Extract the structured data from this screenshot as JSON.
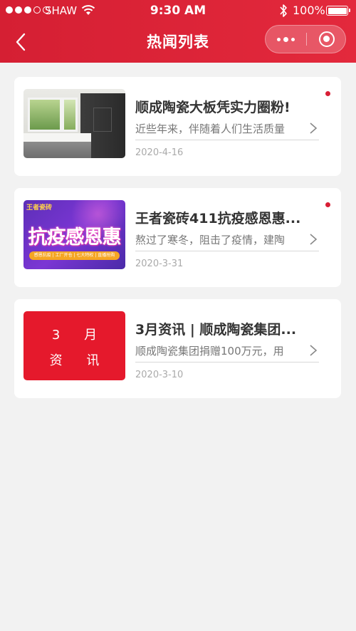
{
  "status_bar": {
    "carrier": "SHAW",
    "time": "9:30 AM",
    "battery": "100%",
    "signal_icon": "signal-dots-icon",
    "wifi_icon": "wifi-icon",
    "bluetooth_icon": "bluetooth-icon"
  },
  "nav": {
    "title": "热闻列表",
    "back_icon": "chevron-left-icon",
    "more_icon": "more-dots-icon",
    "close_icon": "target-circle-icon"
  },
  "colors": {
    "brand_red": "#d51f33",
    "unread_dot": "#d81e35",
    "background": "#f2f2f2"
  },
  "news": [
    {
      "title": "顺成陶瓷大板凭实力圈粉!",
      "summary": "近些年来，伴随着人们生活质量",
      "date": "2020-4-16",
      "unread": true,
      "thumbnail": "kitchen-photo"
    },
    {
      "title": "王者瓷砖411抗疫感恩惠...",
      "summary": "熬过了寒冬，阻击了疫情，建陶",
      "date": "2020-3-31",
      "unread": true,
      "thumbnail": "promo-banner",
      "thumbnail_text": {
        "brand": "王者瓷砖",
        "headline": "抗疫感恩惠",
        "tags": "感恩抗疫 | 工厂开仓 | 七大特权 | 直播抢购"
      }
    },
    {
      "title": "3月资讯 | 顺成陶瓷集团...",
      "summary": "顺成陶瓷集团捐赠100万元，用",
      "date": "2020-3-10",
      "unread": false,
      "thumbnail": "red-text-tile",
      "thumbnail_text": {
        "line1": "3 月",
        "line2": "资 讯"
      }
    }
  ]
}
